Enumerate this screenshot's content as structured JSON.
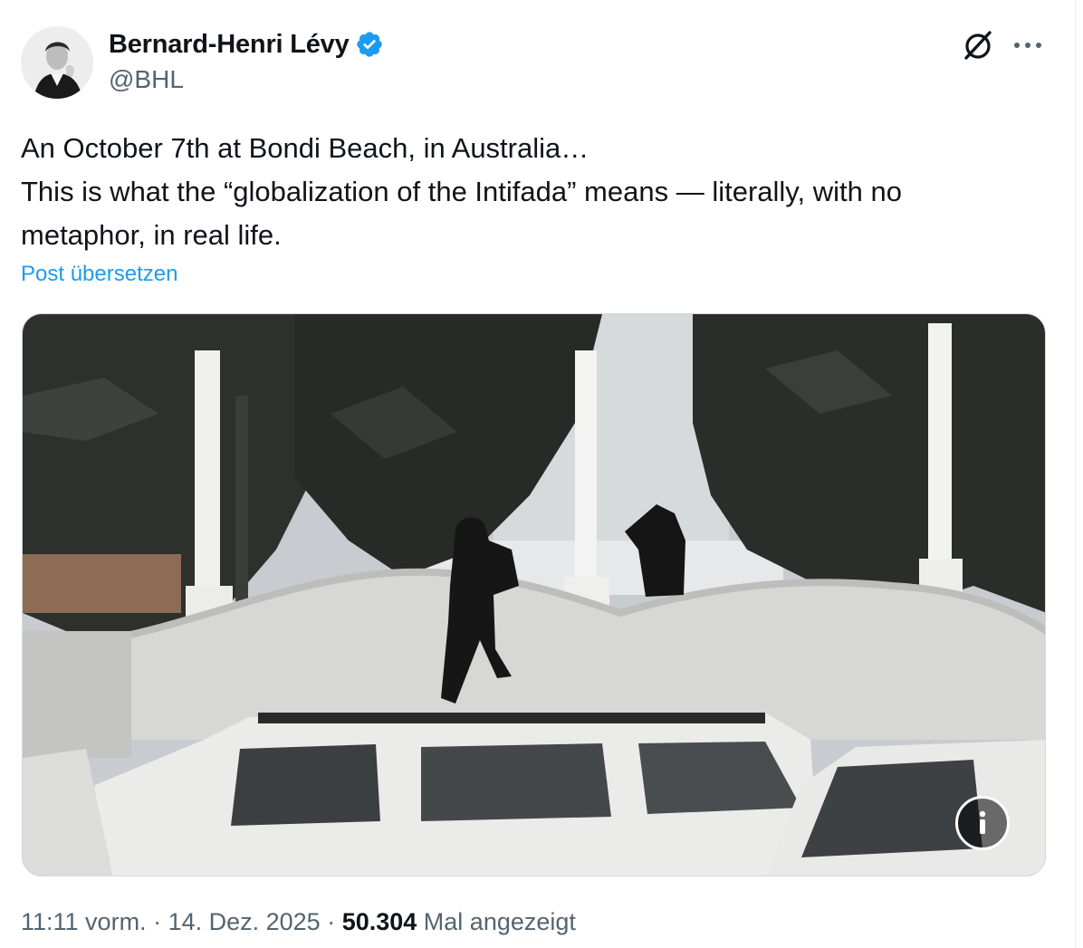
{
  "author": {
    "display_name": "Bernard-Henri Lévy",
    "handle": "@BHL",
    "verified": true,
    "verified_color": "#1d9bf0"
  },
  "actions": {
    "grok_icon": "grok-icon",
    "more_label": "···"
  },
  "post": {
    "lines": [
      "An October 7th at Bondi Beach, in Australia…",
      "This is what the “globalization of the Intifada” means — literally, with no",
      "metaphor, in real life."
    ],
    "translate_label": "Post übersetzen"
  },
  "media": {
    "type": "video-still",
    "info_label": "i"
  },
  "meta": {
    "time": "11:11 vorm.",
    "separator": " · ",
    "date": "14. Dez. 2025",
    "views": "50.304",
    "views_suffix": "Mal angezeigt"
  },
  "colors": {
    "text": "#0f1419",
    "secondary": "#536471",
    "link": "#1d9bf0",
    "border": "#cfd9de"
  }
}
